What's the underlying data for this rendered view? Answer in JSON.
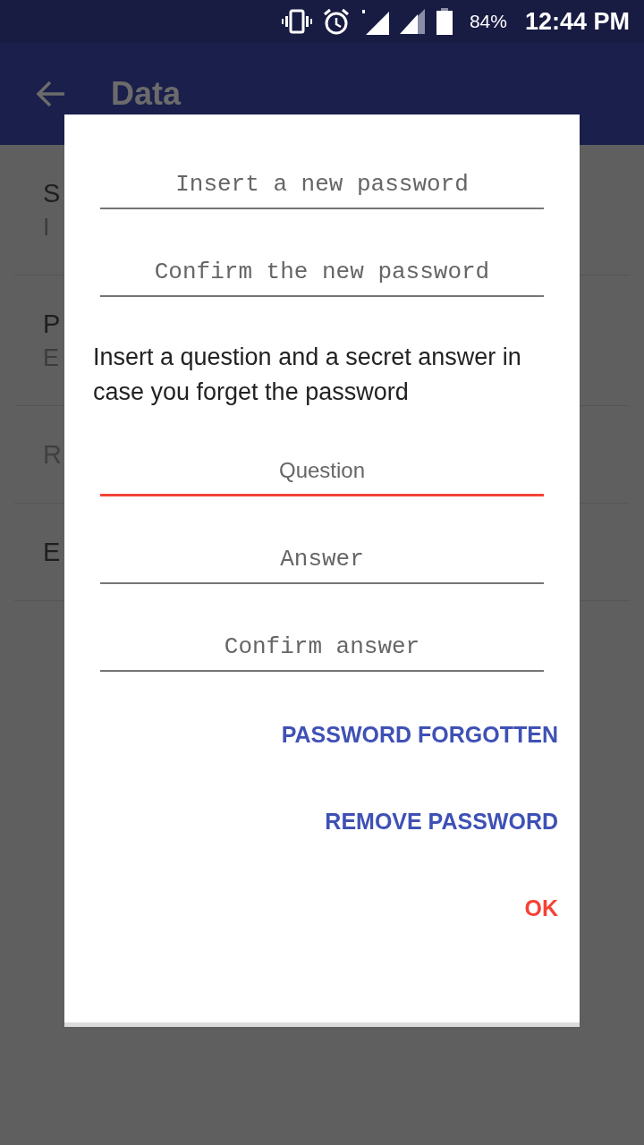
{
  "status_bar": {
    "battery": "84%",
    "time": "12:44 PM"
  },
  "app_bar": {
    "title": "Data"
  },
  "settings": [
    {
      "title": "S",
      "subtitle": "I",
      "disabled": false
    },
    {
      "title": "P",
      "subtitle": "E",
      "disabled": false
    },
    {
      "title": "R",
      "disabled": true
    },
    {
      "title": "E",
      "disabled": false
    }
  ],
  "dialog": {
    "fields_top": [
      {
        "placeholder": "Insert a new password",
        "kind": "password",
        "focused": false
      },
      {
        "placeholder": "Confirm the new password",
        "kind": "password",
        "focused": false
      }
    ],
    "message": "Insert a question and a secret answer in case you forget the password",
    "fields_bottom": [
      {
        "placeholder": "Question",
        "kind": "text",
        "focused": true
      },
      {
        "placeholder": "Answer",
        "kind": "password",
        "focused": false
      },
      {
        "placeholder": "Confirm answer",
        "kind": "password",
        "focused": false
      }
    ],
    "buttons": [
      {
        "label": "PASSWORD FORGOTTEN",
        "kind": "neutral"
      },
      {
        "label": "REMOVE PASSWORD",
        "kind": "neutral"
      },
      {
        "label": "OK",
        "kind": "positive"
      }
    ]
  }
}
